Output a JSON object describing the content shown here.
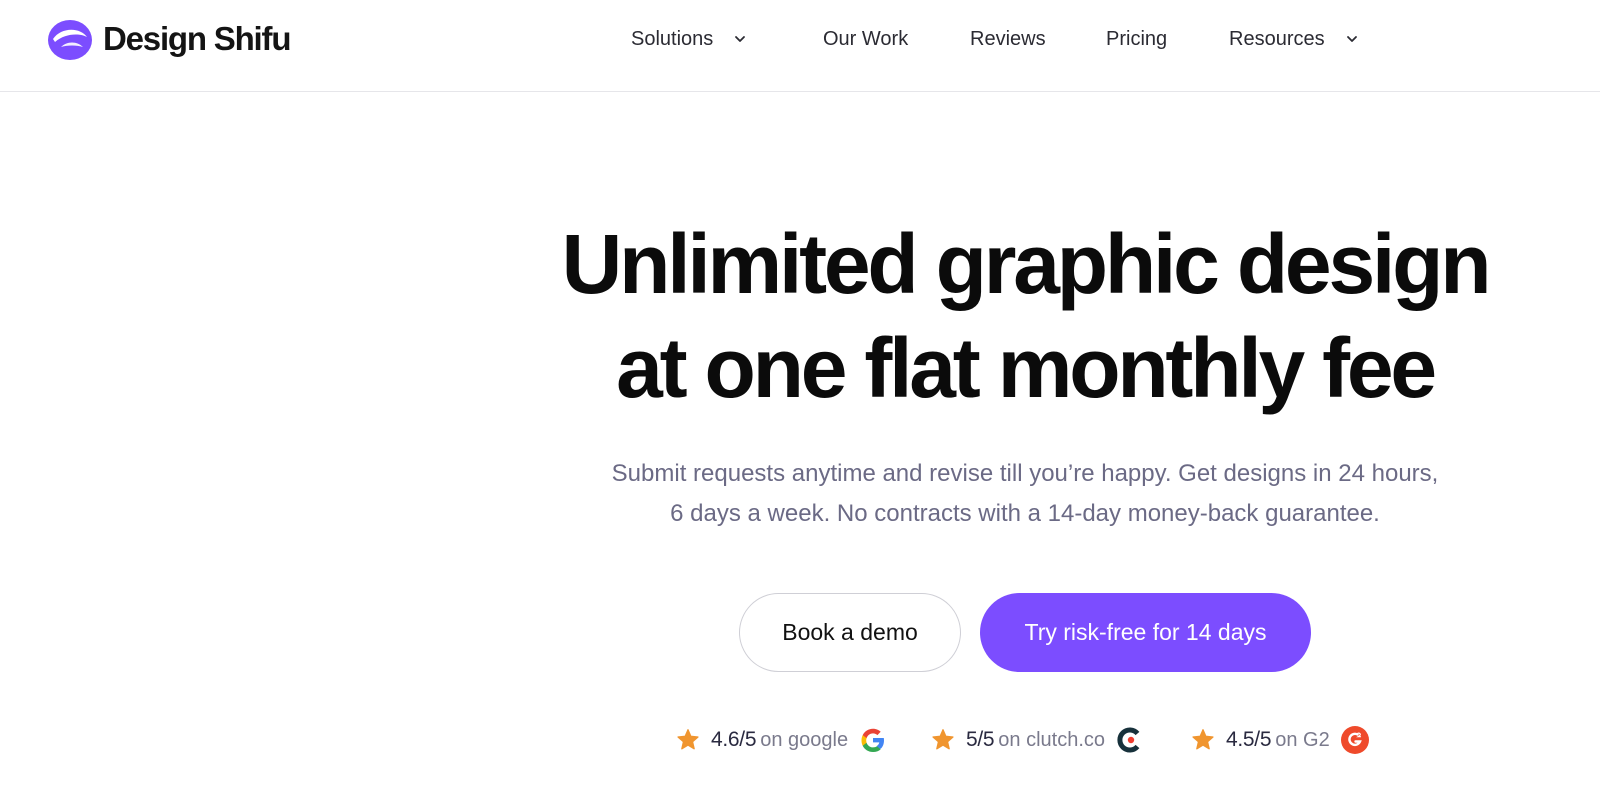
{
  "brand": {
    "name": "Design Shifu",
    "accent": "#7c4dff",
    "logo_icon": "design-shifu-hat-icon"
  },
  "nav": {
    "items": [
      {
        "label": "Solutions",
        "has_dropdown": true
      },
      {
        "label": "Our Work",
        "has_dropdown": false
      },
      {
        "label": "Reviews",
        "has_dropdown": false
      },
      {
        "label": "Pricing",
        "has_dropdown": false
      },
      {
        "label": "Resources",
        "has_dropdown": true
      }
    ],
    "dropdown_icon": "chevron-down-icon"
  },
  "hero": {
    "title_line1": "Unlimited graphic design",
    "title_line2": "at one flat monthly fee",
    "subtitle_line1": "Submit requests anytime and revise till you’re happy. Get designs in 24 hours,",
    "subtitle_line2": "6 days a week. No contracts with a 14-day money-back guarantee.",
    "subtitle_color": "#6b6a85"
  },
  "cta": {
    "secondary_label": "Book a demo",
    "primary_label": "Try risk-free for 14 days",
    "primary_color": "#7c4dff"
  },
  "ratings": [
    {
      "score": "4.6/5",
      "source": "on google",
      "icon": "google-icon"
    },
    {
      "score": "5/5",
      "source": "on clutch.co",
      "icon": "clutch-icon"
    },
    {
      "score": "4.5/5",
      "source": "on G2",
      "icon": "g2-icon"
    }
  ],
  "colors": {
    "star": "#f0952f",
    "g2": "#ef4a2b",
    "clutch": "#17313b",
    "clutch_dot": "#ef3d2f"
  }
}
